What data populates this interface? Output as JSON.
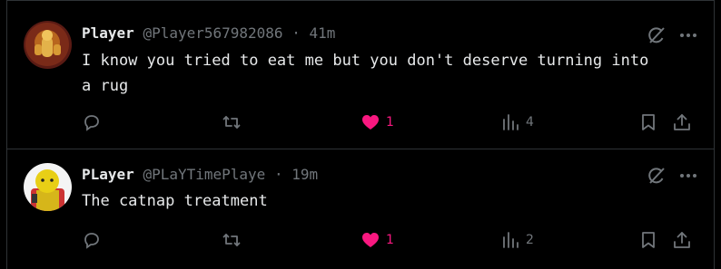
{
  "posts": [
    {
      "name": "Player",
      "handle": "@Player567982086",
      "dot": "·",
      "time": "41m",
      "text": "I know you tried to eat me but you don't deserve turning into\na rug",
      "likes": "1",
      "views": "4",
      "liked": true
    },
    {
      "name": "PLayer",
      "handle": "@PLaYTimePlaye",
      "dot": "·",
      "time": "19m",
      "text": "The catnap treatment",
      "likes": "1",
      "views": "2",
      "liked": true
    }
  ],
  "colors": {
    "background": "#000000",
    "text": "#e7e9ea",
    "muted": "#71767b",
    "like": "#f91880",
    "border": "#2f3336"
  }
}
